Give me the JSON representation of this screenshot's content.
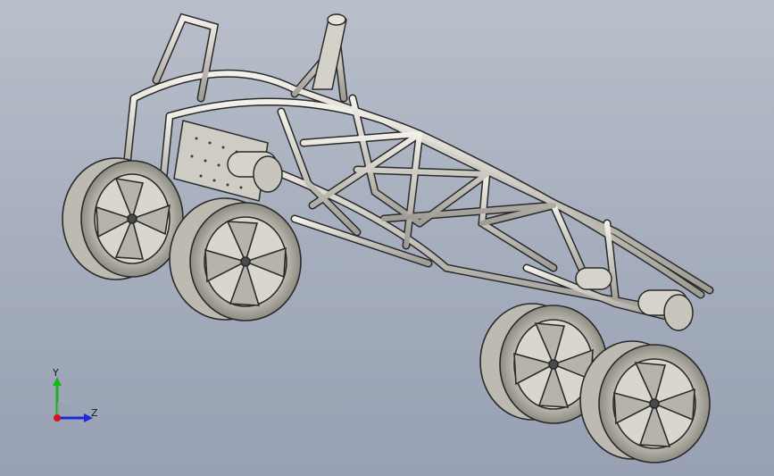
{
  "viewport": {
    "background_top": "#b9bfca",
    "background_bottom": "#97a1b3",
    "model_color": "#c9c7bd",
    "edge_color": "#2a2a2a"
  },
  "triad": {
    "y_label": "Y",
    "z_label": "Z",
    "x_axis_color": "#d11818",
    "y_axis_color": "#19b519",
    "z_axis_color": "#1b2bd8"
  },
  "icons": {
    "triad": "axis-triad-icon"
  }
}
